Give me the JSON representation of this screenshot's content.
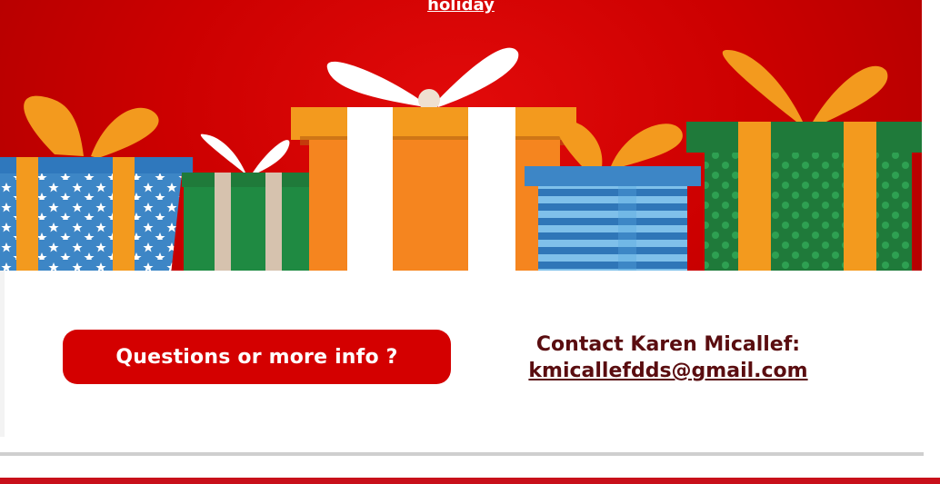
{
  "banner": {
    "link_text": "holiday",
    "background_color": "#d10000"
  },
  "gifts": [
    "blue-star-gift",
    "green-cream-gift",
    "orange-white-gift",
    "blue-striped-gift",
    "green-dotted-gift"
  ],
  "cta": {
    "button_label": "Questions or more info ?",
    "button_color": "#d40000"
  },
  "contact": {
    "line1": "Contact Karen Micallef:",
    "email": "kmicallefdds@gmail.com",
    "text_color": "#5a0d10"
  },
  "footer": {
    "band_color": "#c8101a"
  }
}
